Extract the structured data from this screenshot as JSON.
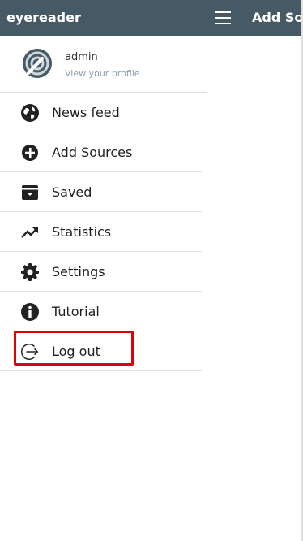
{
  "sidebar": {
    "app_title": "eyereader",
    "profile": {
      "name": "admin",
      "subtitle": "View your profile"
    },
    "items": [
      {
        "label": "News feed",
        "icon": "globe-icon"
      },
      {
        "label": "Add Sources",
        "icon": "plus-circle-icon"
      },
      {
        "label": "Saved",
        "icon": "archive-box-icon"
      },
      {
        "label": "Statistics",
        "icon": "trending-up-icon"
      },
      {
        "label": "Settings",
        "icon": "gear-icon"
      },
      {
        "label": "Tutorial",
        "icon": "info-circle-icon"
      },
      {
        "label": "Log out",
        "icon": "logout-icon"
      }
    ]
  },
  "topbar": {
    "title": "Add So"
  },
  "colors": {
    "header_bg": "#455a64",
    "highlight": "#e30000"
  }
}
